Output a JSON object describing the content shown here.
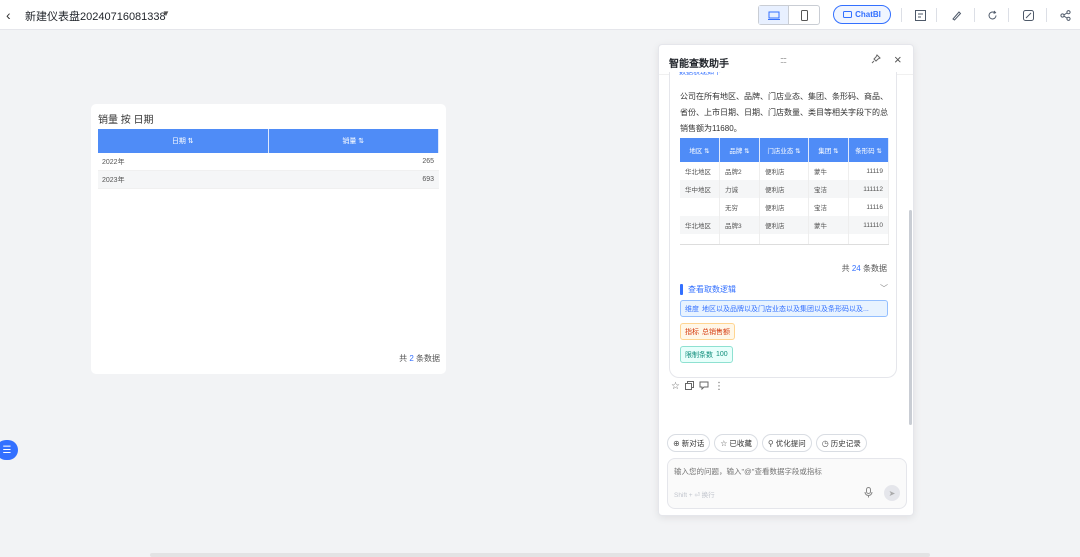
{
  "topbar": {
    "title": "新建仪表盘20240716081338",
    "chatbi_label": "ChatBI"
  },
  "card": {
    "title": "销量 按 日期",
    "columns": [
      "日期 ⇅",
      "销量 ⇅"
    ],
    "rows": [
      [
        "2022年",
        "265"
      ],
      [
        "2023年",
        "693"
      ]
    ],
    "footer_prefix": "共",
    "footer_count": "2",
    "footer_suffix": "条数据"
  },
  "assistant": {
    "title": "智能查数助手",
    "cut_heading": "数据表现如下",
    "summary": "公司在所有地区、品牌、门店业态、集团、条形码、商品、省份、上市日期、日期、门店数量、类目等相关字段下的总销售额为11680。",
    "result_columns": [
      "地区 ⇅",
      "品牌 ⇅",
      "门店业态 ⇅",
      "集团 ⇅",
      "条形码 ⇅"
    ],
    "result_rows": [
      [
        "华北地区",
        "品牌2",
        "便利店",
        "蒙牛",
        "11119"
      ],
      [
        "华中地区",
        "力诚",
        "便利店",
        "宝洁",
        "111112"
      ],
      [
        "",
        "无穷",
        "便利店",
        "宝洁",
        "11116"
      ],
      [
        "华北地区",
        "品牌3",
        "便利店",
        "蒙牛",
        "111110"
      ]
    ],
    "result_count_prefix": "共",
    "result_count": "24",
    "result_count_suffix": "条数据",
    "logic_label": "查看取数逻辑",
    "tag_dimension_label": "维度",
    "tag_dimension_value": "地区以及品牌以及门店业态以及集团以及条形码以及...",
    "tag_indicator_label": "指标",
    "tag_indicator_value": "总销售额",
    "tag_limit_label": "限制条数",
    "tag_limit_value": "100",
    "quick_actions": [
      "新对话",
      "已收藏",
      "优化提问",
      "历史记录"
    ],
    "input_placeholder": "输入您的问题，输入\"@\"查看数据字段或指标",
    "input_hint": "Shift + ⏎ 换行"
  }
}
